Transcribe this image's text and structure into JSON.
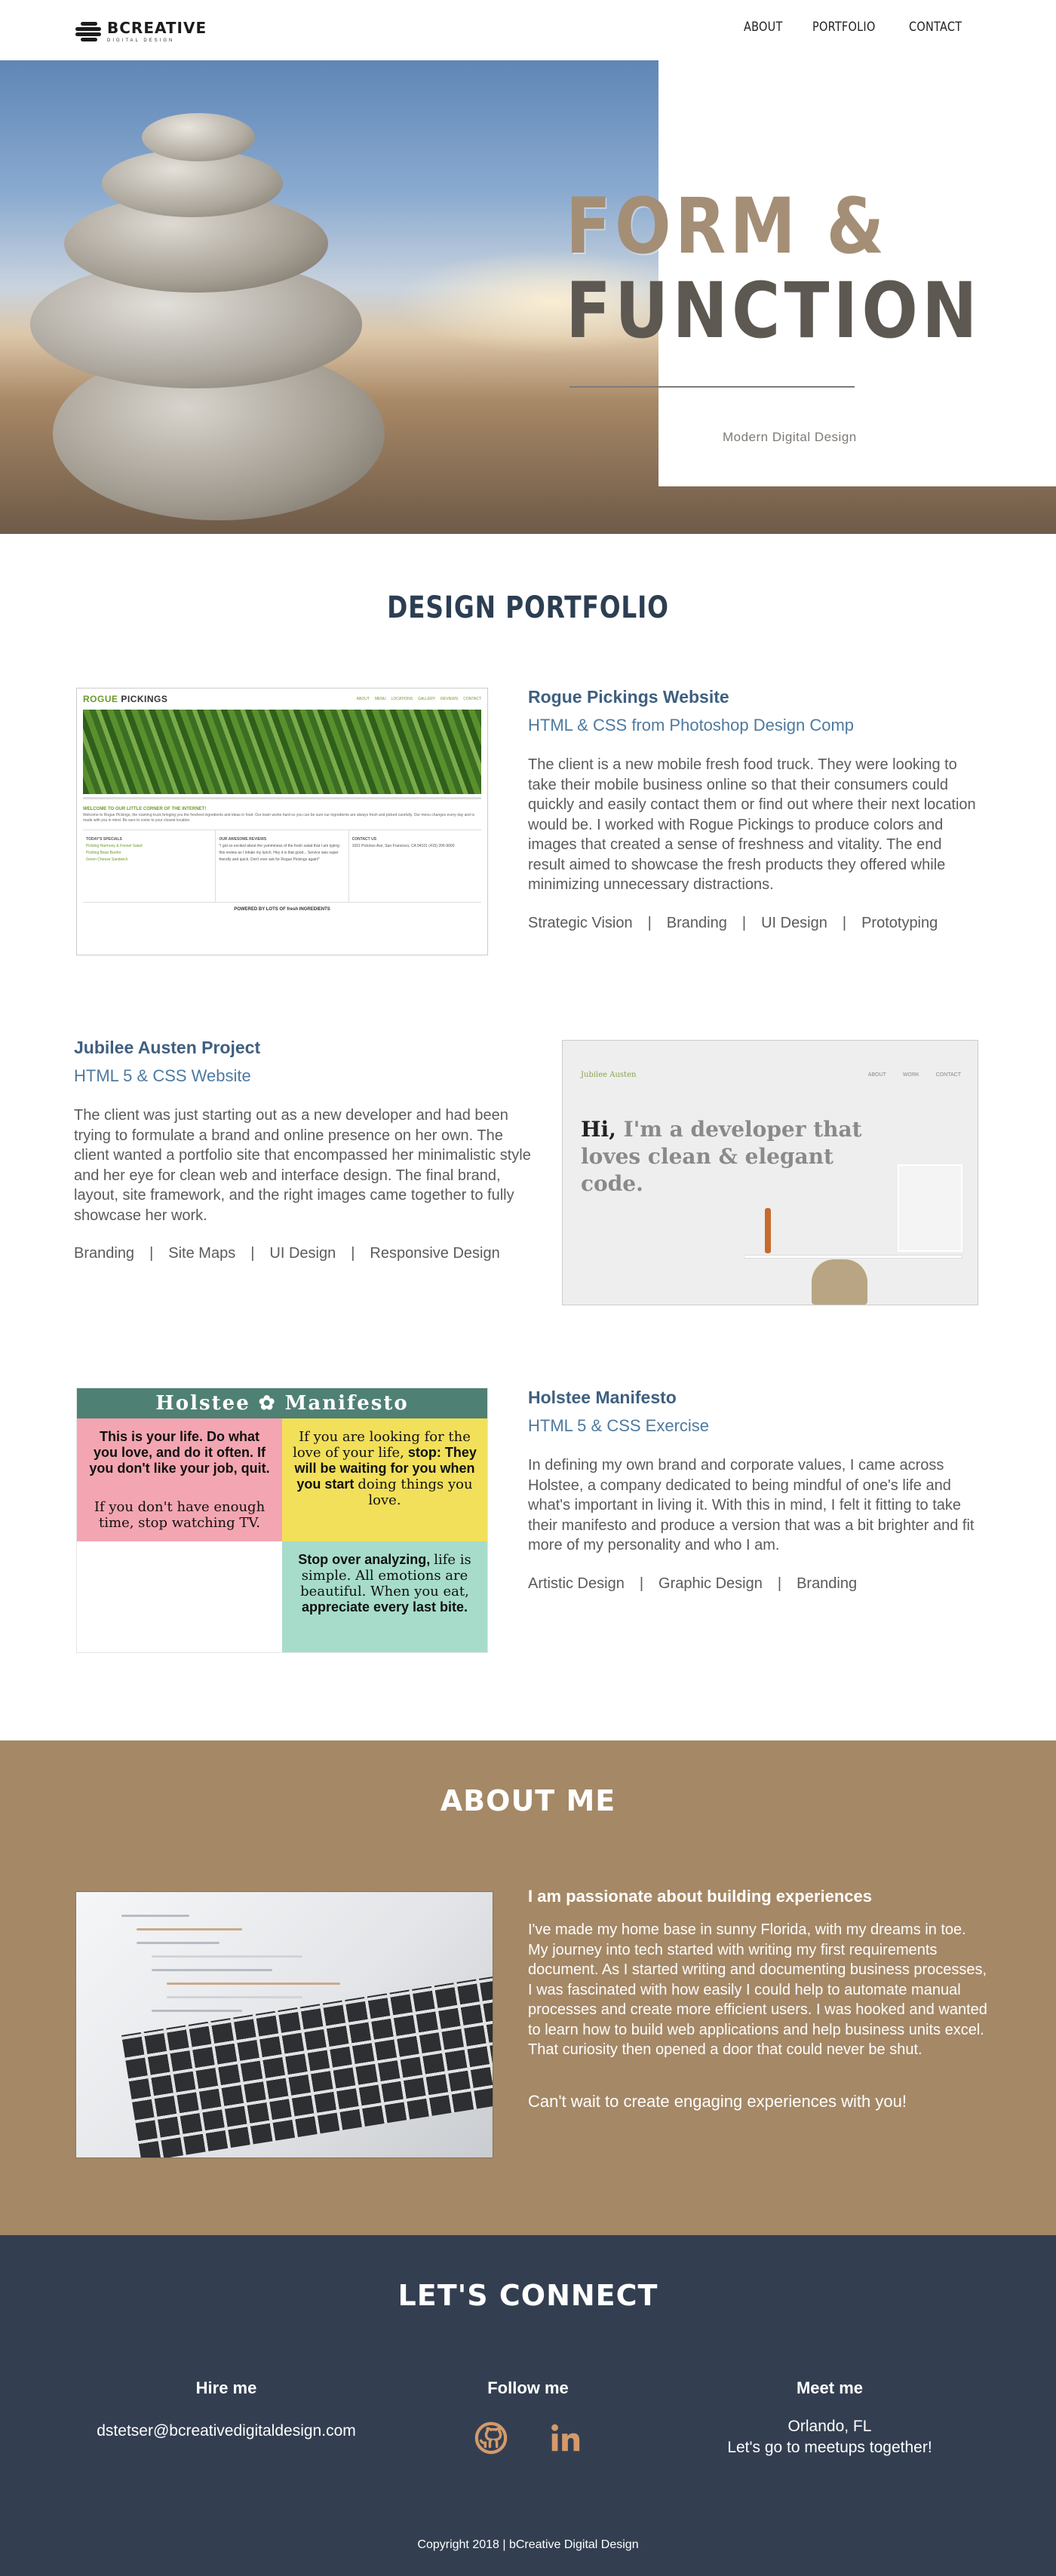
{
  "nav": {
    "logo_text": "BCREATIVE",
    "logo_subtext": "DIGITAL DESIGN",
    "links": [
      "ABOUT",
      "PORTFOLIO",
      "CONTACT"
    ]
  },
  "hero": {
    "title_line1": "FORM &",
    "title_line2": "FUNCTION",
    "subtitle": "Modern Digital Design"
  },
  "portfolio": {
    "title": "DESIGN PORTFOLIO",
    "projects": [
      {
        "title": "Rogue Pickings Website",
        "subtitle": "HTML & CSS from Photoshop Design Comp",
        "description": "The client is a new mobile fresh food truck. They were looking to take their mobile business online so that their consumers could quickly and easily contact them or find out where their next location would be. I worked with Rogue Pickings to produce colors and images that created a sense of freshness and vitality. The end result aimed to showcase the fresh products they offered while minimizing unnecessary distractions.",
        "tags": [
          "Strategic Vision",
          "Branding",
          "UI Design",
          "Prototyping"
        ],
        "mock": {
          "logo": "ROGUE",
          "logo2": "PICKINGS",
          "nav": [
            "ABOUT",
            "MENU",
            "LOCATIONS",
            "GALLERY",
            "REVIEWS",
            "CONTACT"
          ],
          "welcome": "WELCOME TO OUR LITTLE CORNER OF THE INTERNET!",
          "body": "Welcome to Rogue Pickings, the roaming truck bringing you the freshest ingredients and ideas in food. Our team works hard so you can be sure our ingredients are always fresh and picked carefully. Our menu changes every day and is made with you in mind. Be sure to come to your closest location.",
          "col1_head": "TODAY'S SPECIALS",
          "col1_items": [
            "Pickling Harmony & Fennel Salad",
            "Pickling Bean Burrito",
            "Green Cheese Sandwich"
          ],
          "col2_head": "OUR AWESOME REVIEWS",
          "col2_body": "\"I got so excited about the yumminess of the fresh salad that I am typing this review as I inhale my lunch. Hey it is that good... Service was super friendly and quick. Don't ever ask for Rogue Pickings again!\"",
          "col3_head": "CONTACT US",
          "col3_body": "1001 Pickinso Ave, San Francisco, CA 94101 (415) 206-9000",
          "footer": "POWERED BY LOTS OF fresh INGREDIENTS"
        }
      },
      {
        "title": "Jubilee Austen Project",
        "subtitle": "HTML 5 & CSS Website",
        "description": "The client was just starting out as a new developer and had been trying to formulate a brand and online presence on her own. The client wanted a portfolio site that encompassed her minimalistic style and her eye for clean web and interface design. The final brand, layout, site framework, and the right images came together to fully showcase her work.",
        "tags": [
          "Branding",
          "Site Maps",
          "UI Design",
          "Responsive Design"
        ],
        "mock": {
          "logo": "Jubilee Austen",
          "nav": [
            "ABOUT",
            "WORK",
            "CONTACT"
          ],
          "hi": "Hi,",
          "tagline": "I'm a developer that loves clean & elegant code."
        }
      },
      {
        "title": "Holstee Manifesto",
        "subtitle": "HTML 5 & CSS Exercise",
        "description": "In defining my own brand and corporate values, I came across Holstee, a company dedicated to being mindful of one's life and what's important in living it. With this in mind, I felt it fitting to take their manifesto and produce a version that was a bit brighter and fit more of my personality and who I am.",
        "tags": [
          "Artistic Design",
          "Graphic Design",
          "Branding"
        ],
        "mock": {
          "header": "Holstee ✿ Manifesto",
          "cell1_a": "This is your life. Do what you love, and do it often. If you don't like your job, quit.",
          "cell1_b": "If you don't have enough time, stop watching TV.",
          "cell2_a": "If you are looking for the love of your life,",
          "cell2_b": "stop: They will be waiting for you when you start",
          "cell2_c": "doing things you love.",
          "cell3_a": "Stop over analyzing,",
          "cell3_b": "life is simple. All emotions are beautiful. When you eat,",
          "cell3_c": "appreciate every last bite."
        }
      }
    ]
  },
  "about": {
    "title": "ABOUT ME",
    "heading": "I am passionate about building experiences",
    "body": "I've made my home base in sunny Florida, with my dreams in toe. My journey into tech started with writing my first requirements document. As I started writing and documenting business processes, I was fascinated with how easily I could help to automate manual processes and create more efficient users. I was hooked and wanted to learn how to build web applications and help business units excel. That curiosity then opened a door that could never be shut.",
    "cta": "Can't wait to create engaging experiences with you!"
  },
  "connect": {
    "title": "LET'S CONNECT",
    "hire_head": "Hire me",
    "email": "dstetser@bcreativedigitaldesign.com",
    "follow_head": "Follow me",
    "icons": [
      "github-icon",
      "linkedin-icon"
    ],
    "meet_head": "Meet me",
    "meet_line1": "Orlando, FL",
    "meet_line2": "Let's go to meetups together!",
    "copyright": "Copyright 2018  |  bCreative Digital Design"
  },
  "colors": {
    "navy": "#2c3e52",
    "link_blue": "#4d7aa0",
    "tan": "#a58866",
    "slate": "#333f51",
    "accent_orange": "#d49a6a"
  }
}
